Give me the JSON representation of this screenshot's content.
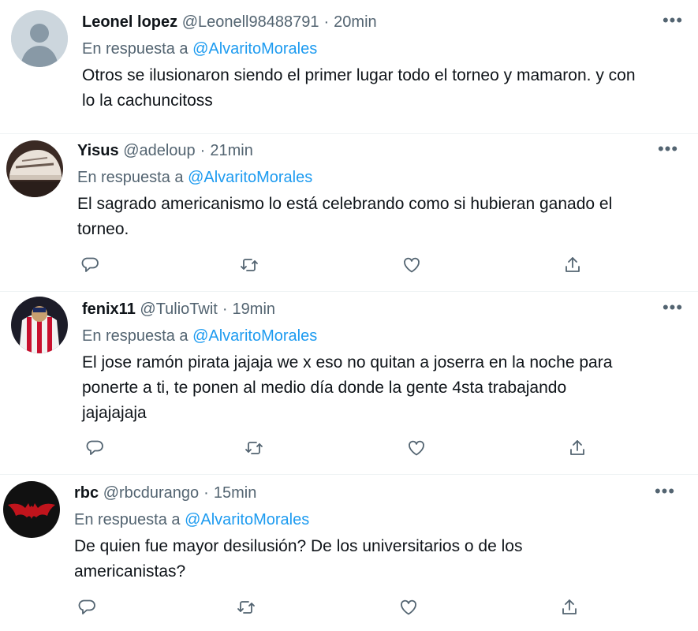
{
  "reply_prefix": "En respuesta a",
  "tweets": [
    {
      "name": "Leonel lopez",
      "handle": "@Leonell98488791",
      "time": "20min",
      "reply_to": "@AlvaritoMorales",
      "text_lines": [
        "Otros se ilusionaron siendo el primer lugar todo el torneo y mamaron. y con",
        "lo la cachuncitoss"
      ],
      "avatar": "default-avatar-icon"
    },
    {
      "name": "Yisus",
      "handle": "@adeloup",
      "time": "21min",
      "reply_to": "@AlvaritoMorales",
      "text_lines": [
        "El sagrado americanismo lo está celebrando como si hubieran ganado el",
        "torneo."
      ],
      "avatar": "cap-avatar"
    },
    {
      "name": "fenix11",
      "handle": "@TulioTwit",
      "time": "19min",
      "reply_to": "@AlvaritoMorales",
      "text_lines": [
        "El jose ramón pirata jajaja we x eso no quitan a joserra en la noche para",
        "ponerte a ti,  te ponen al medio día donde la gente 4sta trabajando",
        "jajajajaja"
      ],
      "avatar": "striped-jersey-avatar"
    },
    {
      "name": "rbc",
      "handle": "@rbcdurango",
      "time": "15min",
      "reply_to": "@AlvaritoMorales",
      "text_lines": [
        "De quien fue mayor desilusión? De los universitarios o de los",
        "americanistas?"
      ],
      "avatar": "red-bat-logo-avatar"
    }
  ],
  "colors": {
    "link": "#1d9bf0",
    "muted": "#536471",
    "text": "#0f1419"
  }
}
